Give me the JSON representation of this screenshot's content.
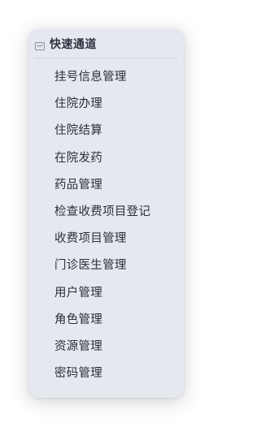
{
  "panel": {
    "title": "快速通道",
    "icon": "collapse-icon",
    "items": [
      {
        "label": "挂号信息管理"
      },
      {
        "label": "住院办理"
      },
      {
        "label": "住院结算"
      },
      {
        "label": "在院发药"
      },
      {
        "label": "药品管理"
      },
      {
        "label": "检查收费项目登记"
      },
      {
        "label": "收费项目管理"
      },
      {
        "label": "门诊医生管理"
      },
      {
        "label": "用户管理"
      },
      {
        "label": "角色管理"
      },
      {
        "label": "资源管理"
      },
      {
        "label": "密码管理"
      }
    ]
  },
  "colors": {
    "panel_background": "#e6e8ef",
    "text": "#2b2f3a"
  }
}
